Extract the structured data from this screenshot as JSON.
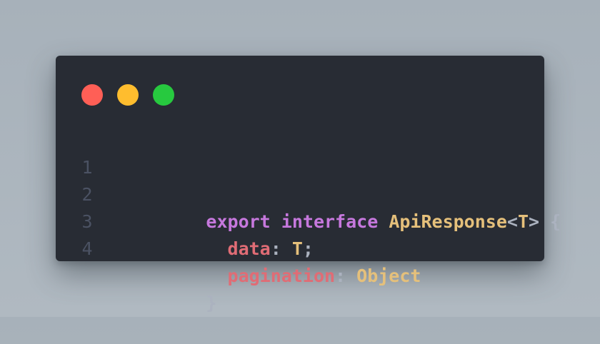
{
  "window": {
    "background": "#282c34",
    "traffic_lights": [
      {
        "name": "close",
        "color": "#ff5f56"
      },
      {
        "name": "minimize",
        "color": "#ffbd2e"
      },
      {
        "name": "zoom",
        "color": "#27c93f"
      }
    ]
  },
  "code": {
    "language": "typescript",
    "lines": [
      {
        "number": "1",
        "tokens": [
          {
            "text": "export",
            "color": "#c678dd"
          },
          {
            "text": " ",
            "color": "#abb2bf"
          },
          {
            "text": "interface",
            "color": "#c678dd"
          },
          {
            "text": " ",
            "color": "#abb2bf"
          },
          {
            "text": "ApiResponse",
            "color": "#e5c07b"
          },
          {
            "text": "<",
            "color": "#abb2bf"
          },
          {
            "text": "T",
            "color": "#e5c07b"
          },
          {
            "text": "> {",
            "color": "#abb2bf"
          }
        ]
      },
      {
        "number": "2",
        "tokens": [
          {
            "text": "  ",
            "color": "#abb2bf"
          },
          {
            "text": "data",
            "color": "#e06c75"
          },
          {
            "text": ": ",
            "color": "#abb2bf"
          },
          {
            "text": "T",
            "color": "#e5c07b"
          },
          {
            "text": ";",
            "color": "#abb2bf"
          }
        ]
      },
      {
        "number": "3",
        "tokens": [
          {
            "text": "  ",
            "color": "#abb2bf"
          },
          {
            "text": "pagination",
            "color": "#e06c75"
          },
          {
            "text": ": ",
            "color": "#abb2bf"
          },
          {
            "text": "Object",
            "color": "#e5c07b"
          }
        ]
      },
      {
        "number": "4",
        "tokens": [
          {
            "text": "}",
            "color": "#abb2bf"
          }
        ]
      }
    ]
  }
}
